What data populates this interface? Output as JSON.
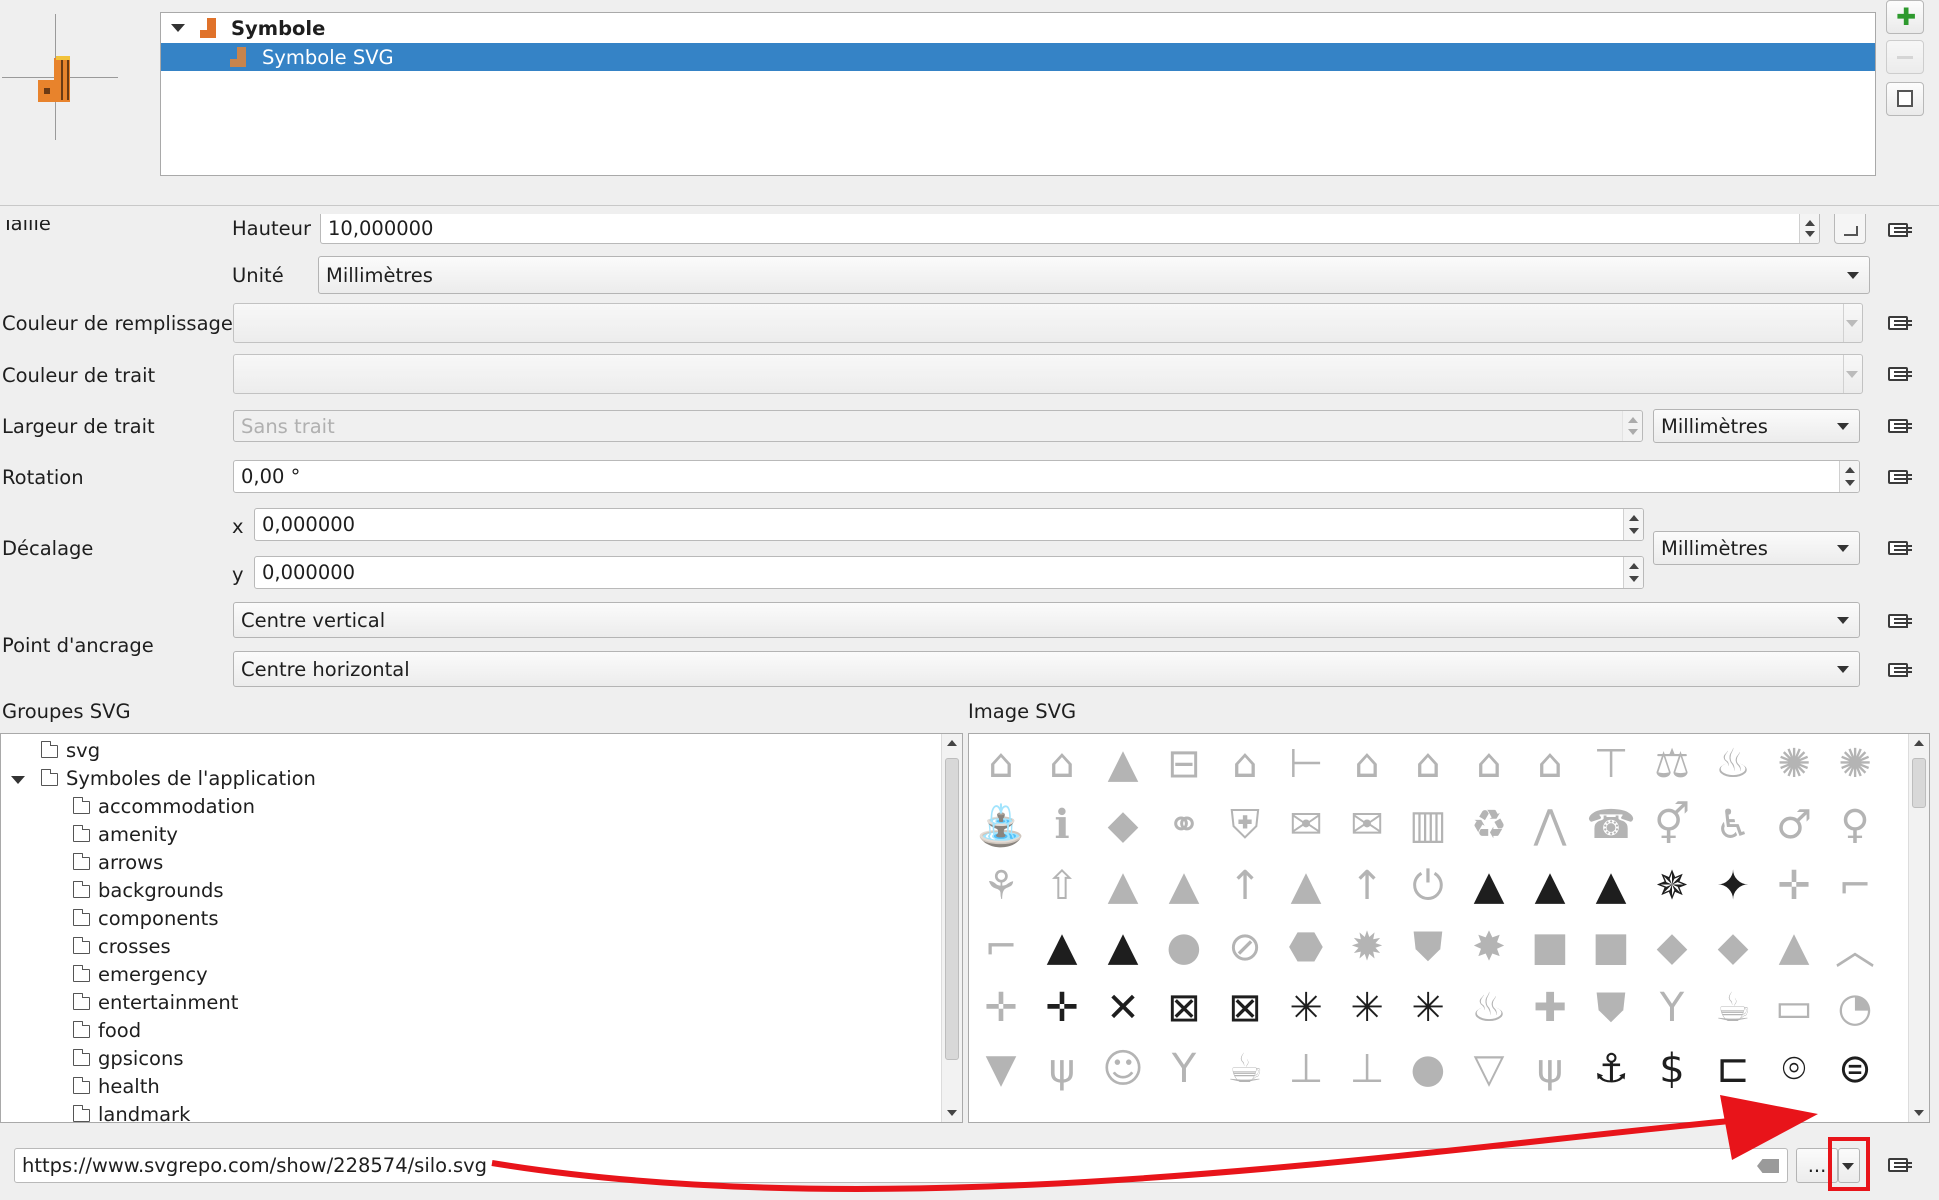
{
  "symbol_tree": {
    "root_label": "Symbole",
    "child_label": "Symbole SVG"
  },
  "labels": {
    "taille": "Taille",
    "hauteur": "Hauteur",
    "unite": "Unité",
    "fill_color": "Couleur de remplissage",
    "stroke_color": "Couleur de trait",
    "stroke_width": "Largeur de trait",
    "rotation": "Rotation",
    "offset": "Décalage",
    "offset_x": "x",
    "offset_y": "y",
    "anchor": "Point d'ancrage",
    "svg_groups": "Groupes SVG",
    "svg_image": "Image SVG"
  },
  "fields": {
    "hauteur_value": "10,000000",
    "unite_value": "Millimètres",
    "stroke_width_placeholder": "Sans trait",
    "stroke_width_unit": "Millimètres",
    "rotation_value": "0,00 °",
    "offset_x_value": "0,000000",
    "offset_y_value": "0,000000",
    "offset_unit": "Millimètres",
    "anchor_vertical": "Centre vertical",
    "anchor_horizontal": "Centre horizontal",
    "svg_path": "https://www.svgrepo.com/show/228574/silo.svg",
    "browse_label": "..."
  },
  "svg_groups": {
    "top_items": [
      "svg",
      "Symboles de l'application"
    ],
    "children": [
      "accommodation",
      "amenity",
      "arrows",
      "backgrounds",
      "components",
      "crosses",
      "emergency",
      "entertainment",
      "food",
      "gpsicons",
      "health",
      "landmark"
    ]
  },
  "svg_icons": [
    [
      "⌂",
      "⌂",
      "▲",
      "⊟",
      "⌂",
      "⊢",
      "⌂",
      "⌂",
      "⌂",
      "⌂",
      "⊤",
      "⚖",
      "♨",
      "✺",
      "✺"
    ],
    [
      "⛲",
      "ℹ",
      "◆",
      "⚭",
      "⛨",
      "✉",
      "✉",
      "▥",
      "♻",
      "⋀",
      "☎",
      "⚥",
      "♿",
      "♂",
      "♀"
    ],
    [
      "⚘",
      "⇧",
      "▲",
      "▲",
      "↑",
      "▲",
      "↑",
      "⏻",
      "▲",
      "▲",
      "▲",
      "✵",
      "✦",
      "✛",
      "⌐"
    ],
    [
      "⌐",
      "▲",
      "▲",
      "●",
      "⊘",
      "⬣",
      "✹",
      "⛊",
      "✸",
      "■",
      "■",
      "◆",
      "◆",
      "▲",
      "︿"
    ],
    [
      "✛",
      "✛",
      "✕",
      "⊠",
      "⊠",
      "✳",
      "✳",
      "✳",
      "♨",
      "✚",
      "⛊",
      "Y",
      "☕",
      "▭",
      "◔"
    ],
    [
      "▼",
      "ψ",
      "☺",
      "Y",
      "☕",
      "⊥",
      "⊥",
      "●",
      "▽",
      "ψ",
      "⚓",
      "$",
      "⊏",
      "⌾",
      "⊜"
    ]
  ],
  "colors": {
    "selection": "#3583c6",
    "annotation_red": "#e8141a",
    "icon_gray": "#b4b4b4"
  }
}
